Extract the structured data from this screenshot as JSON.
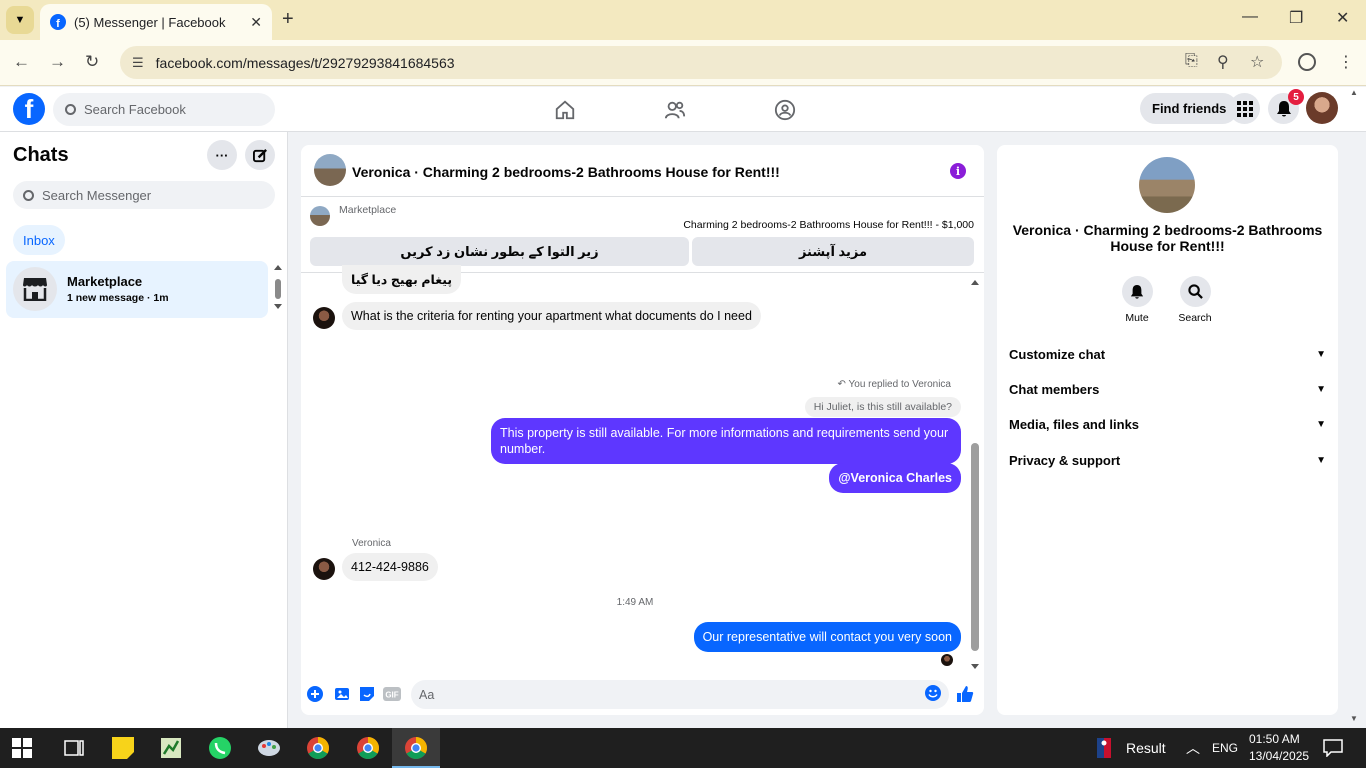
{
  "browser": {
    "tab_title": "(5) Messenger | Facebook",
    "url": "facebook.com/messages/t/29279293841684563"
  },
  "fb": {
    "search_placeholder": "Search Facebook",
    "find_friends": "Find friends",
    "notification_count": "5"
  },
  "chats": {
    "title": "Chats",
    "search_placeholder": "Search Messenger",
    "inbox": "Inbox",
    "items": [
      {
        "name": "Marketplace",
        "subtitle": "1 new message · 1m"
      }
    ]
  },
  "conversation": {
    "title": "Veronica · Charming 2 bedrooms-2 Bathrooms House for Rent!!!",
    "marketplace_label": "Marketplace",
    "listing": "Charming 2 bedrooms-2 Bathrooms House for Rent!!! - $1,000",
    "btn_mark_pending": "زیر التوا کے بطور نشان زد کریں",
    "btn_more_options": "مزید آپشنز",
    "messages": {
      "sent_urdu": "پیغام بھیج دیا گیا",
      "question": "What is the criteria for renting your apartment what documents do I need",
      "replied_label": "You replied to Veronica",
      "quoted": "Hi Juliet, is this still available?",
      "reply_line1": "This property is still available. For more informations and requirements send your",
      "reply_line2": "number.",
      "mention": "@Veronica Charles",
      "sender": "Veronica",
      "phone": "412-424-9886",
      "time": "1:49 AM",
      "last": "Our representative will contact you very soon"
    },
    "composer_placeholder": "Aa"
  },
  "details": {
    "name": "Veronica · Charming 2 bedrooms-2 Bathrooms House for Rent!!!",
    "mute": "Mute",
    "search": "Search",
    "sections": [
      "Customize chat",
      "Chat members",
      "Media, files and links",
      "Privacy & support"
    ]
  },
  "taskbar": {
    "result": "Result",
    "lang": "ENG",
    "time": "01:50 AM",
    "date": "13/04/2025"
  },
  "colors": {
    "fb_blue": "#0866ff",
    "outgoing_bubble": "#5e37ff",
    "info_purple": "#8a1dd8",
    "badge_red": "#e41e3f"
  }
}
